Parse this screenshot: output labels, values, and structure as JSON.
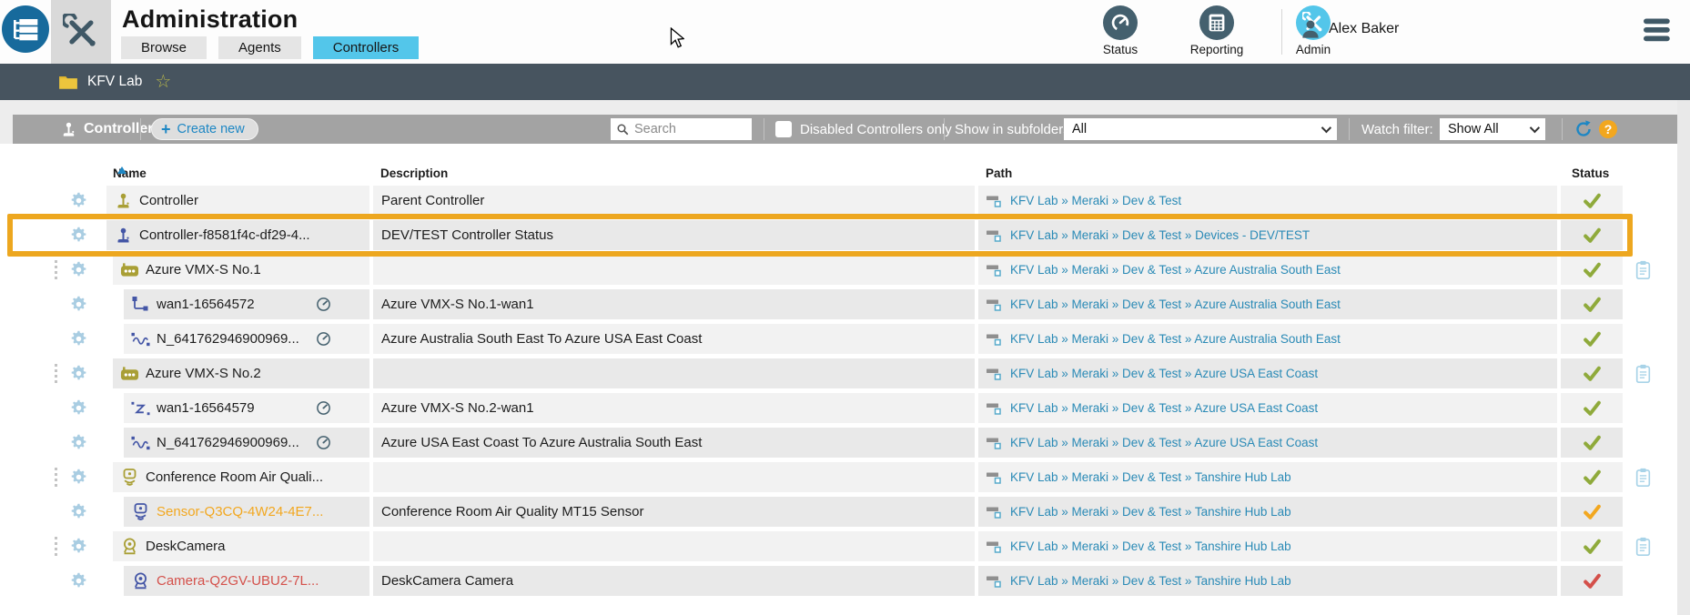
{
  "header": {
    "title": "Administration",
    "tabs": [
      {
        "label": "Browse",
        "active": false
      },
      {
        "label": "Agents",
        "active": false
      },
      {
        "label": "Controllers",
        "active": true
      }
    ],
    "nav": [
      {
        "label": "Status",
        "icon": "gauge-icon"
      },
      {
        "label": "Reporting",
        "icon": "report-icon"
      },
      {
        "label": "Admin",
        "icon": "tools-icon"
      }
    ],
    "user": "Alex Baker"
  },
  "breadcrumb": {
    "folder": "KFV Lab"
  },
  "toolbar": {
    "title": "Controllers",
    "create_label": "Create new",
    "search_placeholder": "Search",
    "checkbox_label": "Disabled Controllers only",
    "subfolders_label": "Show in subfolders:",
    "subfolders_value": "All",
    "watch_label": "Watch filter:",
    "watch_value": "Show All"
  },
  "table": {
    "columns": [
      "Name",
      "Description",
      "Path",
      "Status"
    ],
    "sort_column": "Name",
    "rows": [
      {
        "icon": "joystick",
        "icon_color": "olive",
        "indent": 0,
        "name": "Controller",
        "desc": "Parent Controller",
        "path": "KFV Lab » Meraki » Dev & Test",
        "status": "ok",
        "drag": false,
        "clipboard": false,
        "gauge": false,
        "highlighted": false
      },
      {
        "icon": "joystick",
        "icon_color": "indigo",
        "indent": 0,
        "name": "Controller-f8581f4c-df29-4...",
        "desc": "DEV/TEST Controller Status",
        "path": "KFV Lab » Meraki » Dev & Test » Devices - DEV/TEST",
        "status": "ok",
        "drag": false,
        "clipboard": false,
        "gauge": false,
        "highlighted": true
      },
      {
        "icon": "robot",
        "icon_color": "olive",
        "indent": 1,
        "name": "Azure VMX-S No.1",
        "desc": "",
        "path": "KFV Lab » Meraki » Dev & Test » Azure Australia South East",
        "status": "ok",
        "drag": true,
        "clipboard": true,
        "gauge": false,
        "highlighted": false
      },
      {
        "icon": "branch",
        "icon_color": "indigo",
        "indent": 2,
        "name": "wan1-16564572",
        "desc": "Azure VMX-S No.1-wan1",
        "path": "KFV Lab » Meraki » Dev & Test » Azure Australia South East",
        "status": "ok",
        "drag": false,
        "clipboard": false,
        "gauge": true,
        "highlighted": false
      },
      {
        "icon": "wave",
        "icon_color": "indigo",
        "indent": 2,
        "name": "N_641762946900969...",
        "desc": "Azure Australia South East To Azure USA East Coast",
        "path": "KFV Lab » Meraki » Dev & Test » Azure Australia South East",
        "status": "ok",
        "drag": false,
        "clipboard": false,
        "gauge": true,
        "highlighted": false
      },
      {
        "icon": "robot",
        "icon_color": "olive",
        "indent": 1,
        "name": "Azure VMX-S No.2",
        "desc": "",
        "path": "KFV Lab » Meraki » Dev & Test » Azure USA East Coast",
        "status": "ok",
        "drag": true,
        "clipboard": true,
        "gauge": false,
        "highlighted": false
      },
      {
        "icon": "sleep",
        "icon_color": "indigo",
        "indent": 2,
        "name": "wan1-16564579",
        "desc": "Azure VMX-S No.2-wan1",
        "path": "KFV Lab » Meraki » Dev & Test » Azure USA East Coast",
        "status": "ok",
        "drag": false,
        "clipboard": false,
        "gauge": true,
        "highlighted": false
      },
      {
        "icon": "wave",
        "icon_color": "indigo",
        "indent": 2,
        "name": "N_641762946900969...",
        "desc": "Azure USA East Coast To Azure Australia South East",
        "path": "KFV Lab » Meraki » Dev & Test » Azure USA East Coast",
        "status": "ok",
        "drag": false,
        "clipboard": false,
        "gauge": true,
        "highlighted": false
      },
      {
        "icon": "sensor",
        "icon_color": "olive",
        "indent": 1,
        "name": "Conference Room Air Quali...",
        "desc": "",
        "path": "KFV Lab » Meraki » Dev & Test » Tanshire Hub Lab",
        "status": "ok",
        "drag": true,
        "clipboard": true,
        "gauge": false,
        "highlighted": false
      },
      {
        "icon": "sensor",
        "icon_color": "indigo",
        "indent": 2,
        "name": "Sensor-Q3CQ-4W24-4E7...",
        "name_color": "orange-name",
        "desc": "Conference Room Air Quality MT15 Sensor",
        "path": "KFV Lab » Meraki » Dev & Test » Tanshire Hub Lab",
        "status": "warn",
        "drag": false,
        "clipboard": false,
        "gauge": false,
        "highlighted": false
      },
      {
        "icon": "camera",
        "icon_color": "olive",
        "indent": 1,
        "name": "DeskCamera",
        "desc": "",
        "path": "KFV Lab » Meraki » Dev & Test » Tanshire Hub Lab",
        "status": "ok",
        "drag": true,
        "clipboard": true,
        "gauge": false,
        "highlighted": false
      },
      {
        "icon": "camera",
        "icon_color": "indigo",
        "indent": 2,
        "name": "Camera-Q2GV-UBU2-7L...",
        "name_color": "red-name",
        "desc": "DeskCamera Camera",
        "path": "KFV Lab » Meraki » Dev & Test » Tanshire Hub Lab",
        "status": "err",
        "drag": false,
        "clipboard": false,
        "gauge": false,
        "highlighted": false
      }
    ]
  },
  "colors": {
    "accent": "#1e87c4",
    "cyan": "#53c6ea",
    "slate": "#44606e",
    "olive": "#a99f35",
    "indigo": "#4456a6",
    "green": "#8faa3b",
    "orange": "#f2a71f",
    "red": "#d4504a",
    "link": "#2a8ab6",
    "toolbar": "#a3a3a3",
    "crumb": "#47545f",
    "highlight": "#eda71f",
    "gear": "#a9cde2",
    "clipblue": "#a8d3e8",
    "logoblue": "#176a9c"
  }
}
